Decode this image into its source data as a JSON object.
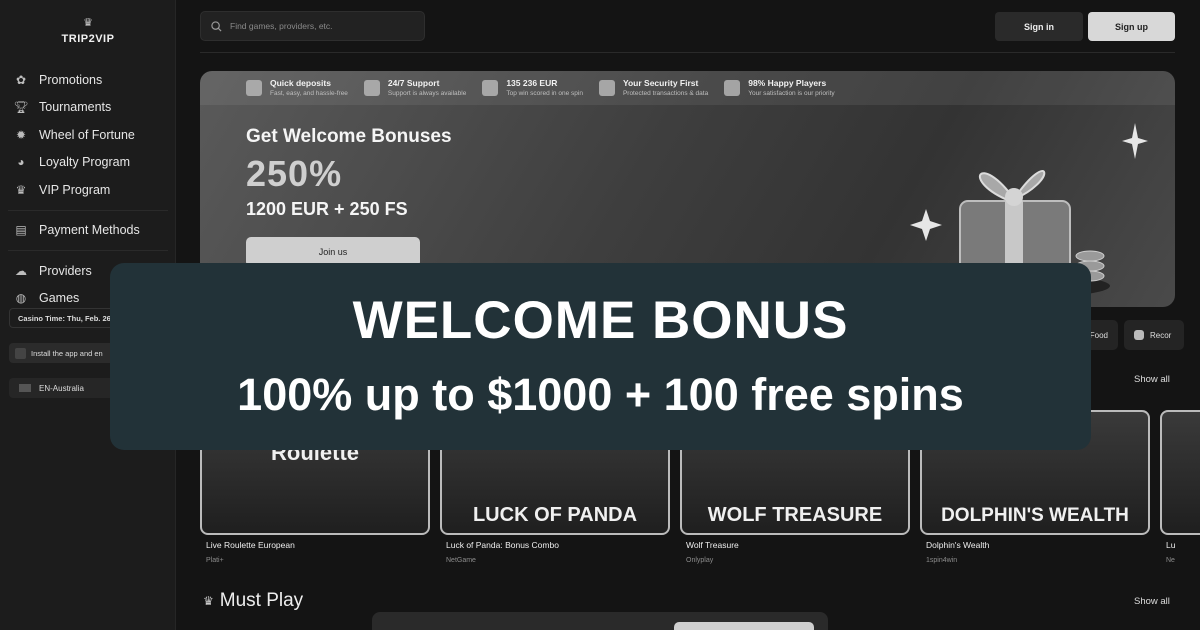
{
  "brand": {
    "logo_text": "TRIP2VIP"
  },
  "sidebar": {
    "items": [
      {
        "label": "Promotions",
        "icon": "promotions-icon"
      },
      {
        "label": "Tournaments",
        "icon": "trophy-icon"
      },
      {
        "label": "Wheel of Fortune",
        "icon": "wheel-icon"
      },
      {
        "label": "Loyalty Program",
        "icon": "loyalty-icon"
      },
      {
        "label": "VIP Program",
        "icon": "crown-icon"
      },
      {
        "label": "Payment Methods",
        "icon": "payment-icon"
      },
      {
        "label": "Providers",
        "icon": "providers-icon"
      },
      {
        "label": "Games",
        "icon": "gamepad-icon"
      }
    ],
    "casino_time": "Casino Time: Thu, Feb. 26,",
    "install_app": "Install the app and en",
    "language": "EN-Australia"
  },
  "header": {
    "search_placeholder": "Find games, providers, etc.",
    "signin_label": "Sign in",
    "signup_label": "Sign up"
  },
  "hero": {
    "features": [
      {
        "title": "Quick deposits",
        "subtitle": "Fast, easy, and hassle-free"
      },
      {
        "title": "24/7 Support",
        "subtitle": "Support is always available"
      },
      {
        "title": "135 236 EUR",
        "subtitle": "Top win scored in one spin"
      },
      {
        "title": "Your Security First",
        "subtitle": "Protected transactions & data"
      },
      {
        "title": "98% Happy Players",
        "subtitle": "Your satisfaction is our priority"
      }
    ],
    "title": "Get Welcome Bonuses",
    "percent": "250%",
    "amount": "1200 EUR + 250 FS",
    "cta": "Join us"
  },
  "chips": {
    "food": "Food",
    "reco": "Recor"
  },
  "sections": {
    "show_all": "Show all",
    "must_play": "Must Play"
  },
  "games": [
    {
      "title": "Live Roulette European",
      "provider": "Plati+",
      "art": "Roulette"
    },
    {
      "title": "Luck of Panda: Bonus Combo",
      "provider": "NetGame",
      "art": "LUCK OF PANDA"
    },
    {
      "title": "Wolf Treasure",
      "provider": "Onlyplay",
      "art": "WOLF TREASURE"
    },
    {
      "title": "Dolphin's Wealth",
      "provider": "1spin4win",
      "art": "DOLPHIN'S WEALTH"
    },
    {
      "title": "Lu",
      "provider": "Ne",
      "art": ""
    }
  ],
  "overlay": {
    "title": "WELCOME BONUS",
    "subtitle": "100% up to $1000 + 100 free spins"
  }
}
